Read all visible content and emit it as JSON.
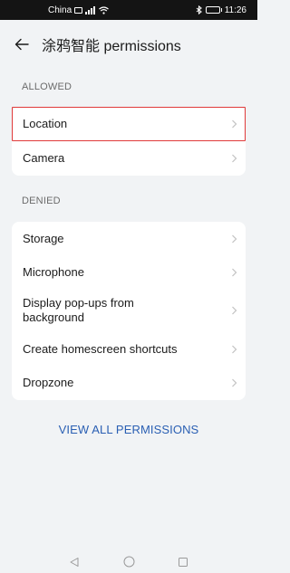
{
  "status_bar": {
    "carrier": "China",
    "time": "11:26",
    "battery_level": 0.9
  },
  "header": {
    "title": "涂鸦智能 permissions",
    "back_icon": "arrow-left-icon"
  },
  "sections": {
    "allowed": {
      "label": "ALLOWED",
      "items": [
        {
          "label": "Location",
          "highlighted": true
        },
        {
          "label": "Camera"
        }
      ]
    },
    "denied": {
      "label": "DENIED",
      "items": [
        {
          "label": "Storage"
        },
        {
          "label": "Microphone"
        },
        {
          "label": "Display pop-ups from background"
        },
        {
          "label": "Create homescreen shortcuts"
        },
        {
          "label": "Dropzone"
        }
      ]
    }
  },
  "footer": {
    "view_all_label": "VIEW ALL PERMISSIONS"
  },
  "colors": {
    "background": "#f1f3f5",
    "card": "#ffffff",
    "link": "#2a5fb3",
    "highlight_border": "#e03a3a"
  },
  "nav_icons": [
    "back-triangle-icon",
    "home-circle-icon",
    "recents-square-icon"
  ]
}
